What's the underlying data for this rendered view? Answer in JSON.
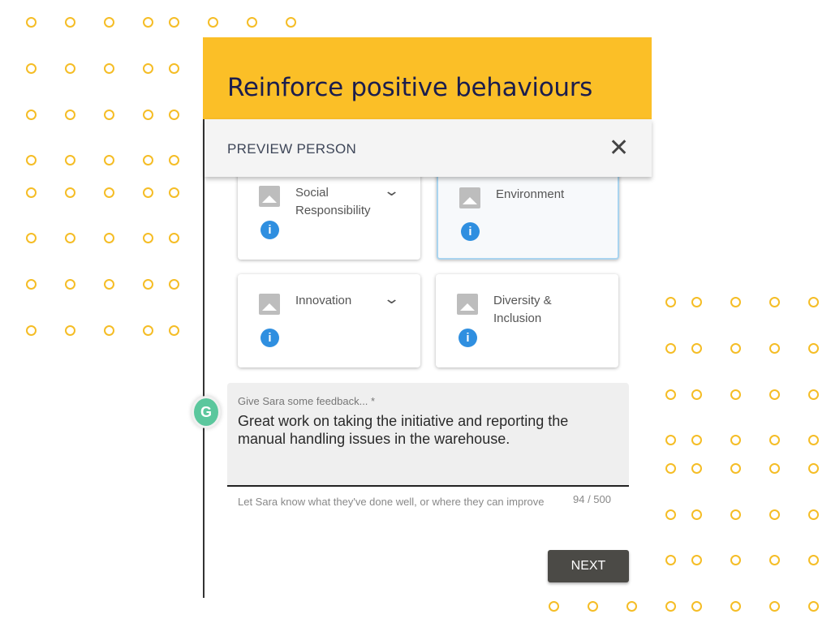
{
  "dialog": {
    "title": "Reinforce positive behaviours",
    "subtitle": "PREVIEW PERSON",
    "close_icon": "close-icon"
  },
  "cards": [
    {
      "label": "Social Responsibility",
      "expandable": true,
      "selected": false
    },
    {
      "label": "Environment",
      "expandable": false,
      "selected": true
    },
    {
      "label": "Innovation",
      "expandable": true,
      "selected": false
    },
    {
      "label": "Diversity & Inclusion",
      "expandable": false,
      "selected": false
    }
  ],
  "feedback": {
    "label": "Give Sara some feedback... *",
    "value": "Great work on taking the initiative and reporting the manual handling issues in the warehouse.",
    "helper": "Let Sara know what they've done well, or where they can improve",
    "counter": "94 / 500"
  },
  "next_label": "NEXT",
  "colors": {
    "accent": "#fbbf27",
    "dots": "#f5bd26",
    "info": "#2f8fe0",
    "button": "#4b4a46"
  }
}
